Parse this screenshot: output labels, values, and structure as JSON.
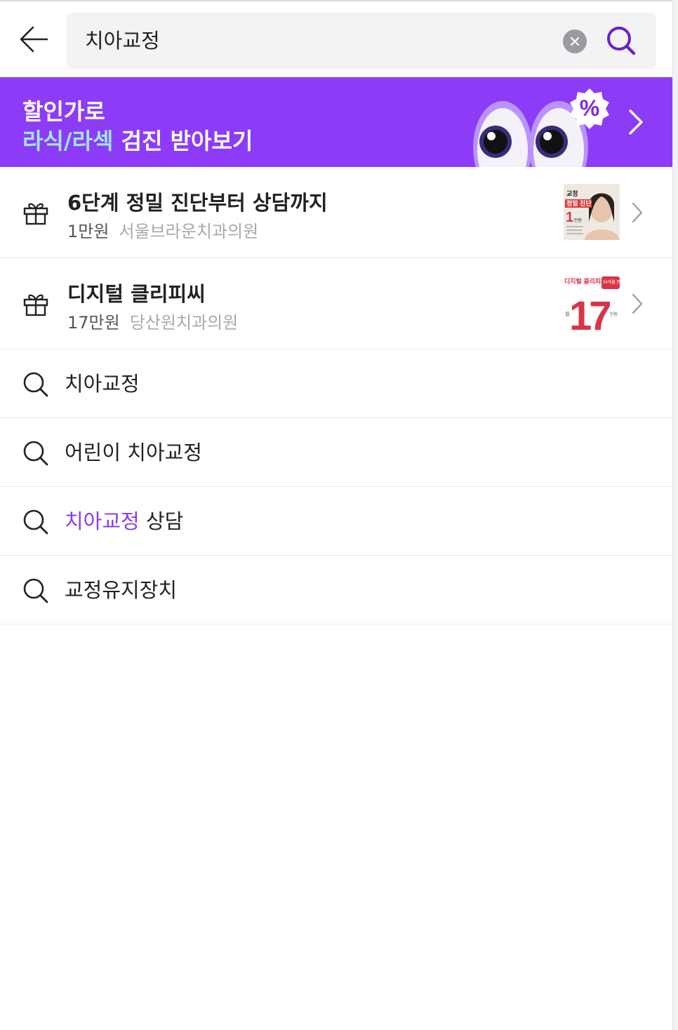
{
  "search": {
    "query": "치아교정"
  },
  "banner": {
    "line1": "할인가로",
    "line2_highlight": "라식/라섹",
    "line2_rest": " 검진 받아보기",
    "badge_symbol": "%",
    "colors": {
      "background": "#8c3cf6",
      "highlight": "#9fe6ff"
    }
  },
  "deals": [
    {
      "title": "6단계 정밀 진단부터 상담까지",
      "price": "1만원",
      "clinic": "서울브라운치과의원",
      "thumb": {
        "tag": "교정",
        "headline": "정밀 진단",
        "value": "1",
        "unit": "만원"
      }
    },
    {
      "title": "디지털 클리피씨",
      "price": "17만원",
      "clinic": "당산원치과의원",
      "thumb": {
        "tag": "디지털 클리피씨",
        "badge": "24개월 분납",
        "prefix": "월",
        "value": "17",
        "unit": "만원"
      }
    }
  ],
  "suggestions": [
    {
      "match": "치아교정",
      "rest": ""
    },
    {
      "match": "",
      "rest": "어린이 치아교정"
    },
    {
      "match": "치아교정",
      "rest": " 상담"
    },
    {
      "match": "",
      "rest": "교정유지장치"
    }
  ],
  "colors": {
    "accent": "#8a3cf0",
    "search_icon": "#6a1fd0"
  }
}
